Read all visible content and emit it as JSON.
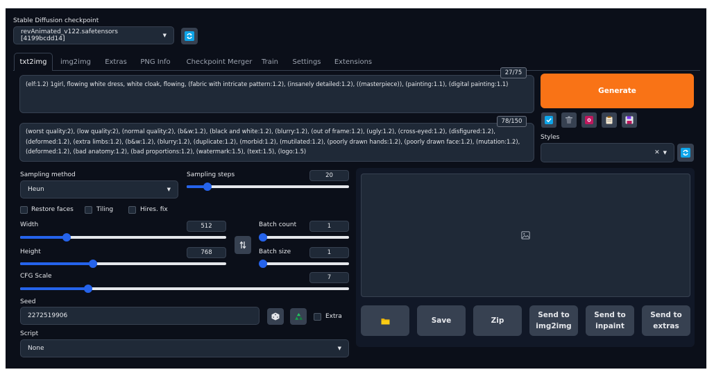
{
  "checkpoint": {
    "label": "Stable Diffusion checkpoint",
    "value": "revAnimated_v122.safetensors [4199bcdd14]",
    "refresh_icon": "refresh-icon"
  },
  "tabs": [
    "txt2img",
    "img2img",
    "Extras",
    "PNG Info",
    "Checkpoint Merger",
    "Train",
    "Settings",
    "Extensions"
  ],
  "active_tab": "txt2img",
  "prompt": {
    "text": "(elf:1.2) 1girl, flowing white dress, white cloak, flowing, (fabric with intricate pattern:1.2), (insanely detailed:1.2), ((masterpiece)), (painting:1.1), (digital painting:1.1)",
    "token_count": "27/75"
  },
  "negative_prompt": {
    "text": "(worst quality:2), (low quality:2), (normal quality:2), (b&w:1.2), (black and white:1.2), (blurry:1.2), (out of frame:1.2), (ugly:1.2), (cross-eyed:1.2), (disfigured:1.2),(deformed:1.2), (extra limbs:1.2), (b&w:1.2), (blurry:1.2), (duplicate:1.2), (morbid:1.2), (mutilated:1.2), (poorly drawn hands:1.2), (poorly drawn face:1.2), (mutation:1.2), (deformed:1.2), (bad anatomy:1.2), (bad proportions:1.2), (watermark:1.5), (text:1.5), (logo:1.5)",
    "token_count": "78/150"
  },
  "generate_label": "Generate",
  "toolbar_icons": [
    "checkbox-icon",
    "trash-icon",
    "palette-icon",
    "clipboard-icon",
    "save-icon"
  ],
  "styles": {
    "label": "Styles",
    "clear_glyph": "✕"
  },
  "sampling_method": {
    "label": "Sampling method",
    "value": "Heun"
  },
  "sampling_steps": {
    "label": "Sampling steps",
    "value": "20",
    "min": 1,
    "max": 150
  },
  "checkboxes": {
    "restore_faces": "Restore faces",
    "tiling": "Tiling",
    "hires_fix": "Hires. fix",
    "extra": "Extra"
  },
  "width": {
    "label": "Width",
    "value": "512",
    "min": 64,
    "max": 2048
  },
  "height": {
    "label": "Height",
    "value": "768",
    "min": 64,
    "max": 2048
  },
  "swap_icon": "swap-icon",
  "batch_count": {
    "label": "Batch count",
    "value": "1",
    "min": 1,
    "max": 100
  },
  "batch_size": {
    "label": "Batch size",
    "value": "1",
    "min": 1,
    "max": 8
  },
  "cfg_scale": {
    "label": "CFG Scale",
    "value": "7",
    "min": 1,
    "max": 30
  },
  "seed": {
    "label": "Seed",
    "value": "2272519906",
    "dice_icon": "dice-icon",
    "recycle_icon": "recycle-icon"
  },
  "script": {
    "label": "Script",
    "value": "None"
  },
  "output": {
    "image_placeholder_icon": "image-icon",
    "folder_icon": "folder-icon",
    "buttons": [
      "Save",
      "Zip",
      "Send to img2img",
      "Send to inpaint",
      "Send to extras"
    ]
  },
  "colors": {
    "accent": "#2563eb",
    "generate": "#f97316",
    "background": "#0b0f19"
  }
}
